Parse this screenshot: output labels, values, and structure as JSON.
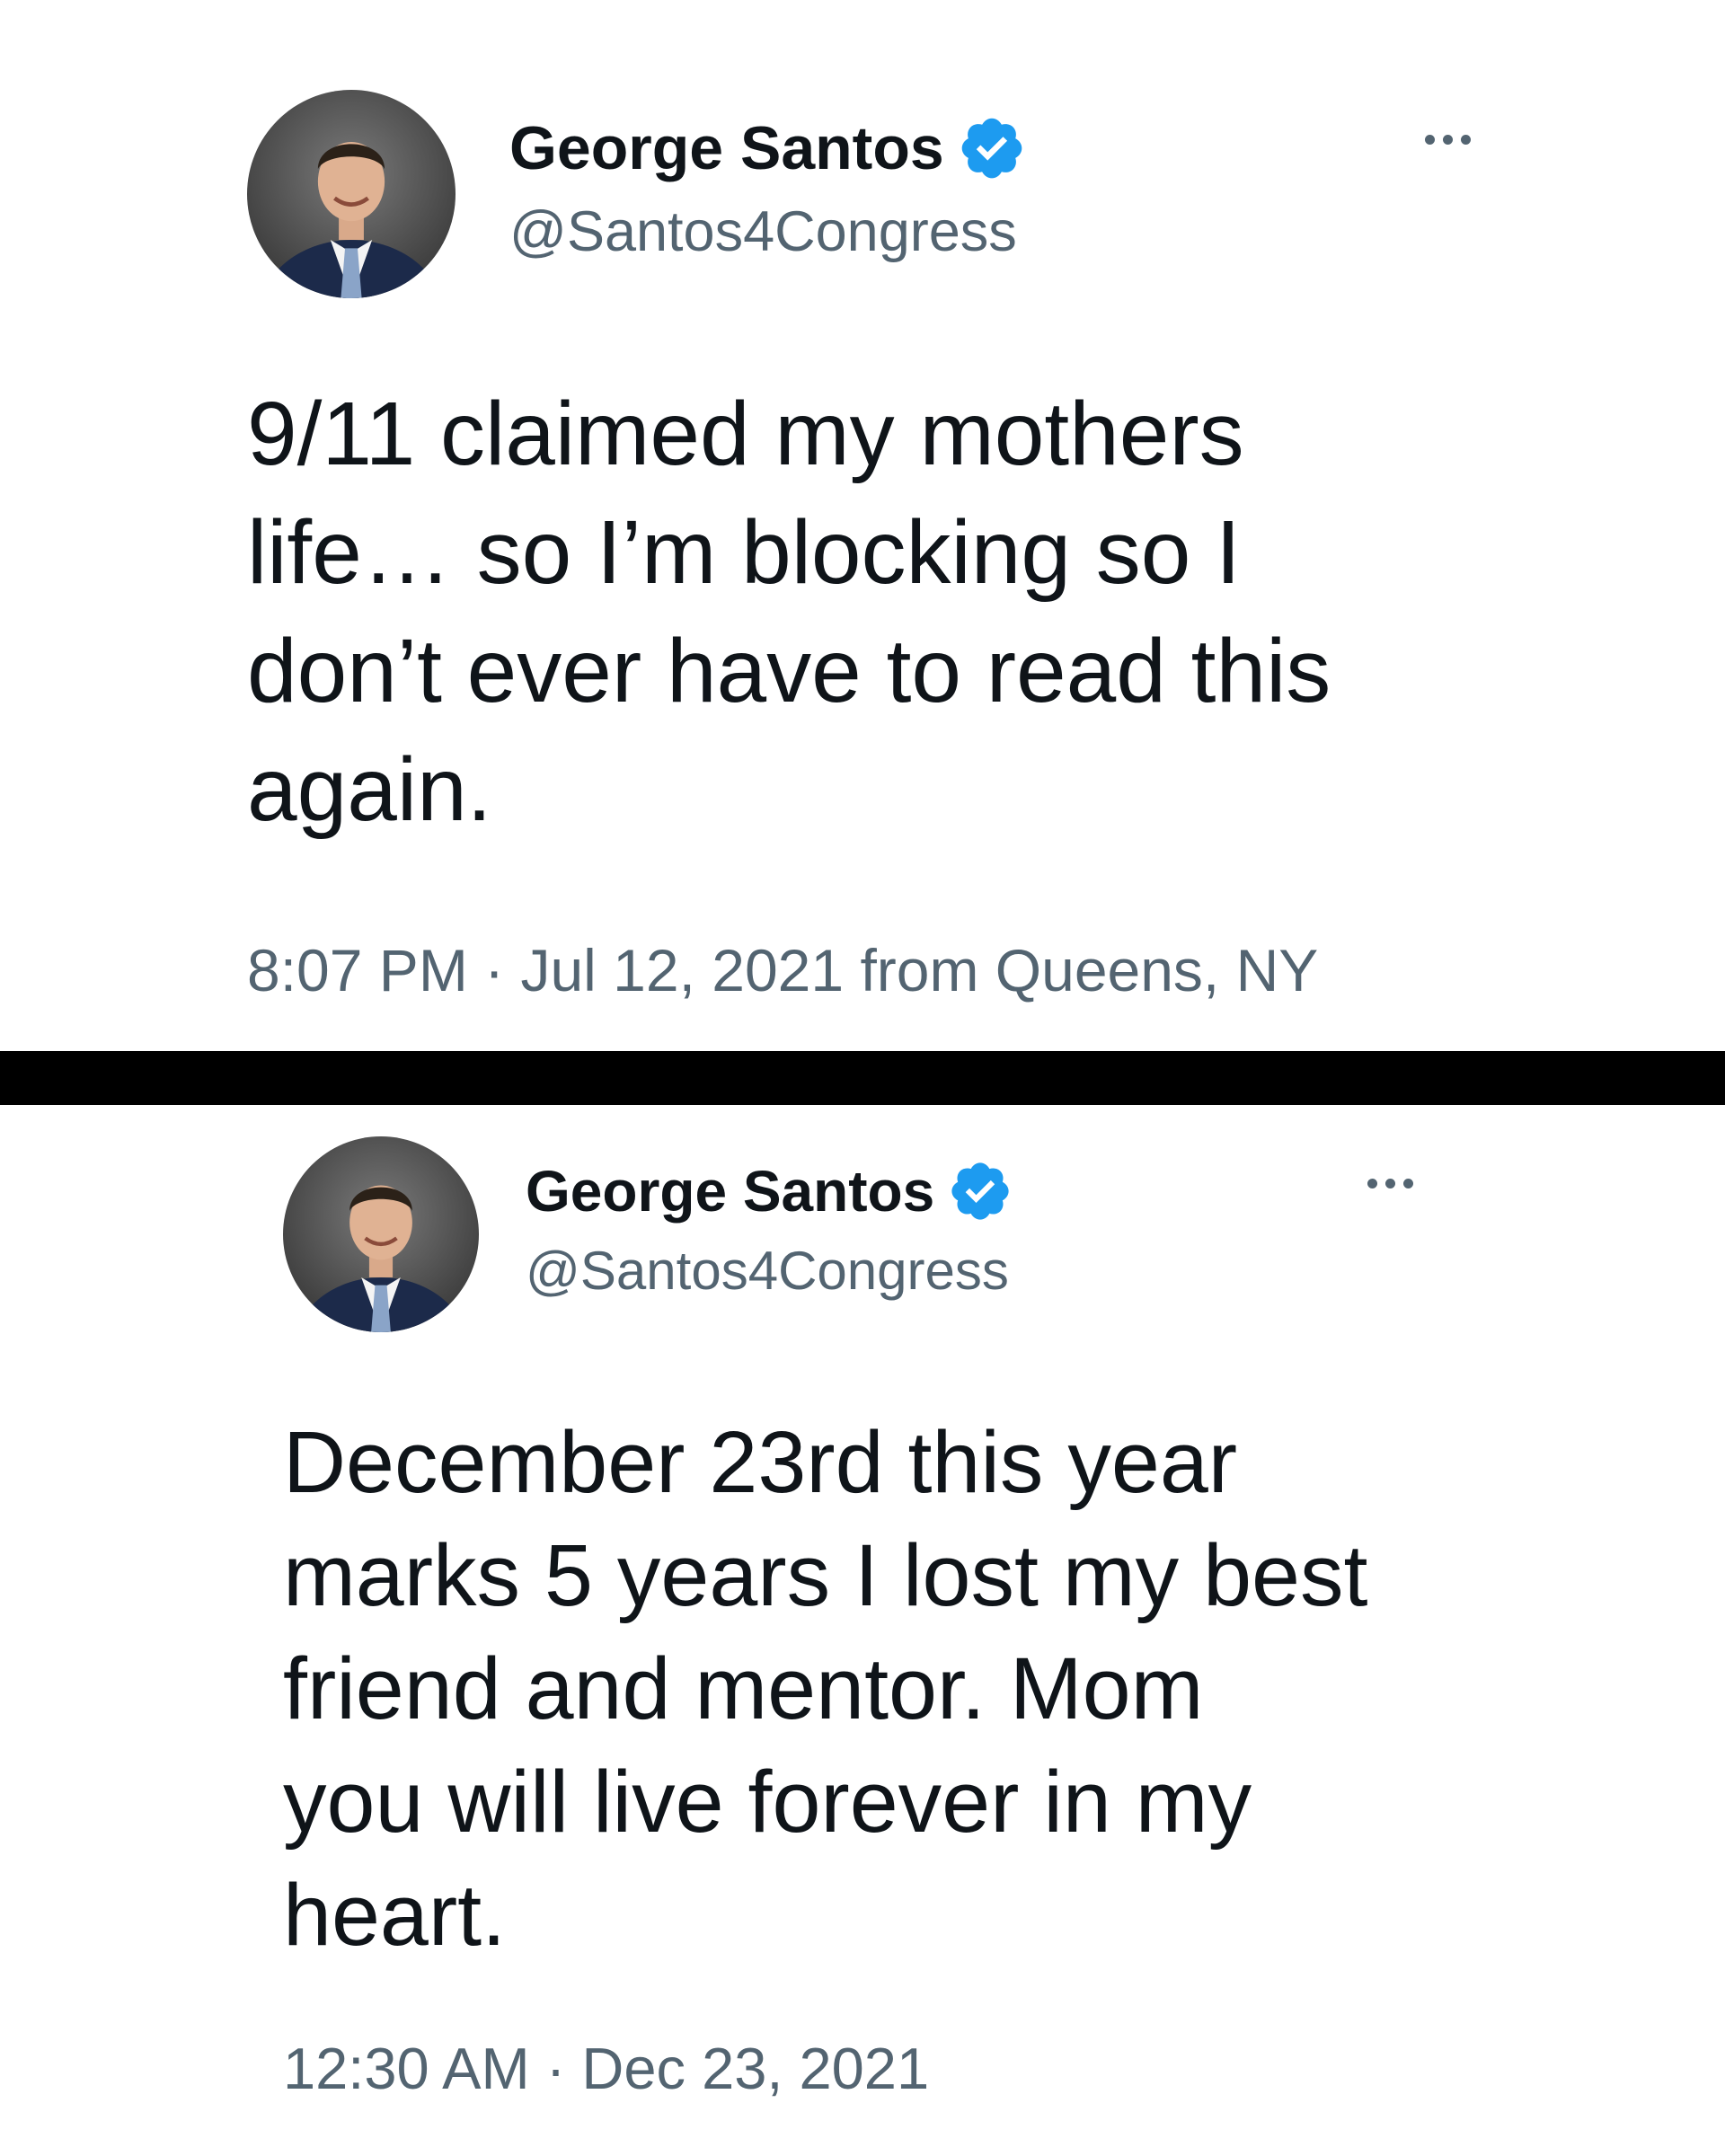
{
  "tweets": [
    {
      "author": {
        "display_name": "George Santos",
        "handle": "@Santos4Congress",
        "verified": true
      },
      "text_lines": [
        "9/11 claimed my mothers",
        "life… so I’m blocking so I",
        "don’t ever have to read this",
        "again."
      ],
      "time": "8:07 PM",
      "separator": "·",
      "date": "Jul 12, 2021",
      "source": "from Queens, NY"
    },
    {
      "author": {
        "display_name": "George Santos",
        "handle": "@Santos4Congress",
        "verified": true
      },
      "text_lines": [
        "December 23rd this year",
        "marks 5 years I lost my best",
        "friend and mentor. Mom",
        "you will live forever in my",
        "heart."
      ],
      "time": "12:30 AM",
      "separator": "·",
      "date": "Dec 23, 2021",
      "source": ""
    }
  ],
  "icons": {
    "verified": "verified-badge-icon",
    "more": "more-options-icon",
    "avatar": "profile-photo"
  },
  "colors": {
    "primary_text": "#0f1419",
    "secondary_text": "#536471",
    "verified_blue": "#1d9bf0",
    "divider": "#000000",
    "background": "#ffffff"
  }
}
